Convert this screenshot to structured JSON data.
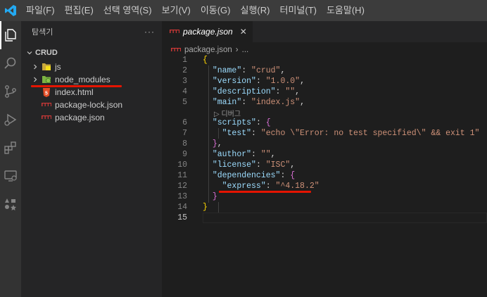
{
  "menubar": {
    "items": [
      "파일(F)",
      "편집(E)",
      "선택 영역(S)",
      "보기(V)",
      "이동(G)",
      "실행(R)",
      "터미널(T)",
      "도움말(H)"
    ]
  },
  "sidebar": {
    "title": "탐색기",
    "more": "···",
    "section": "CRUD",
    "items": [
      {
        "label": "js",
        "icon": "js-folder-icon"
      },
      {
        "label": "node_modules",
        "icon": "node-folder-icon"
      },
      {
        "label": "index.html",
        "icon": "html5-icon"
      },
      {
        "label": "package-lock.json",
        "icon": "npm-icon"
      },
      {
        "label": "package.json",
        "icon": "npm-icon"
      }
    ]
  },
  "editor": {
    "tab": {
      "label": "package.json",
      "close": "✕"
    },
    "breadcrumb": {
      "file": "package.json",
      "sep": "›",
      "more": "..."
    },
    "codelens": "▷ 디버그",
    "line_numbers": [
      "1",
      "2",
      "3",
      "4",
      "5",
      "6",
      "7",
      "8",
      "9",
      "10",
      "11",
      "12",
      "13",
      "14",
      "15"
    ],
    "lines": [
      {
        "segs": [
          [
            "brace",
            "{"
          ]
        ]
      },
      {
        "segs": [
          [
            "pun",
            "  "
          ],
          [
            "key",
            "\"name\""
          ],
          [
            "pun",
            ": "
          ],
          [
            "str",
            "\"crud\""
          ],
          [
            "pun",
            ","
          ]
        ]
      },
      {
        "segs": [
          [
            "pun",
            "  "
          ],
          [
            "key",
            "\"version\""
          ],
          [
            "pun",
            ": "
          ],
          [
            "str",
            "\"1.0.0\""
          ],
          [
            "pun",
            ","
          ]
        ]
      },
      {
        "segs": [
          [
            "pun",
            "  "
          ],
          [
            "key",
            "\"description\""
          ],
          [
            "pun",
            ": "
          ],
          [
            "str",
            "\"\""
          ],
          [
            "pun",
            ","
          ]
        ]
      },
      {
        "segs": [
          [
            "pun",
            "  "
          ],
          [
            "key",
            "\"main\""
          ],
          [
            "pun",
            ": "
          ],
          [
            "str",
            "\"index.js\""
          ],
          [
            "pun",
            ","
          ]
        ]
      },
      {
        "segs": [
          [
            "pun",
            "  "
          ],
          [
            "key",
            "\"scripts\""
          ],
          [
            "pun",
            ": "
          ],
          [
            "brace2",
            "{"
          ]
        ]
      },
      {
        "segs": [
          [
            "pun",
            "    "
          ],
          [
            "key",
            "\"test\""
          ],
          [
            "pun",
            ": "
          ],
          [
            "str",
            "\"echo \\\"Error: no test specified\\\" && exit 1\""
          ]
        ]
      },
      {
        "segs": [
          [
            "pun",
            "  "
          ],
          [
            "brace2",
            "}"
          ],
          [
            "pun",
            ","
          ]
        ]
      },
      {
        "segs": [
          [
            "pun",
            "  "
          ],
          [
            "key",
            "\"author\""
          ],
          [
            "pun",
            ": "
          ],
          [
            "str",
            "\"\""
          ],
          [
            "pun",
            ","
          ]
        ]
      },
      {
        "segs": [
          [
            "pun",
            "  "
          ],
          [
            "key",
            "\"license\""
          ],
          [
            "pun",
            ": "
          ],
          [
            "str",
            "\"ISC\""
          ],
          [
            "pun",
            ","
          ]
        ]
      },
      {
        "segs": [
          [
            "pun",
            "  "
          ],
          [
            "key",
            "\"dependencies\""
          ],
          [
            "pun",
            ": "
          ],
          [
            "brace2",
            "{"
          ]
        ]
      },
      {
        "segs": [
          [
            "pun",
            "    "
          ],
          [
            "key",
            "\"express\""
          ],
          [
            "pun",
            ": "
          ],
          [
            "str",
            "\"^4.18.2\""
          ]
        ]
      },
      {
        "segs": [
          [
            "pun",
            "  "
          ],
          [
            "brace2",
            "}"
          ]
        ]
      },
      {
        "segs": [
          [
            "brace",
            "}"
          ]
        ]
      },
      {
        "segs": []
      }
    ]
  }
}
